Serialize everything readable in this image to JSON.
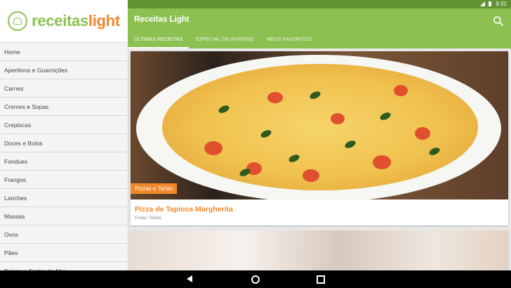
{
  "status": {
    "time": "9:31"
  },
  "app": {
    "title": "Receitas Light"
  },
  "logo": {
    "part1": "receitas",
    "part2": "light"
  },
  "tabs": [
    "ÚLTIMAS RECEITAS",
    "ESPECIAL DE INVERNO",
    "MEUS FAVORITOS"
  ],
  "menu": [
    "Home",
    "Aperitivos e Guarnições",
    "Carnes",
    "Cremes e Sopas",
    "Crepiocas",
    "Doces e Bolos",
    "Fondues",
    "Frangos",
    "Lanches",
    "Massas",
    "Ovos",
    "Pães",
    "Peixes e Frutos do Mar"
  ],
  "card": {
    "category": "Pizzas e Tortas",
    "title": "Pizza de Tapioca Margherita",
    "source": "Fonte: Globo."
  },
  "colors": {
    "primary": "#8cc152",
    "dark": "#5f9431",
    "accent": "#f0882c"
  },
  "icons": {
    "search": "search-icon",
    "back": "back-icon",
    "home": "home-icon",
    "recent": "recent-apps-icon"
  }
}
